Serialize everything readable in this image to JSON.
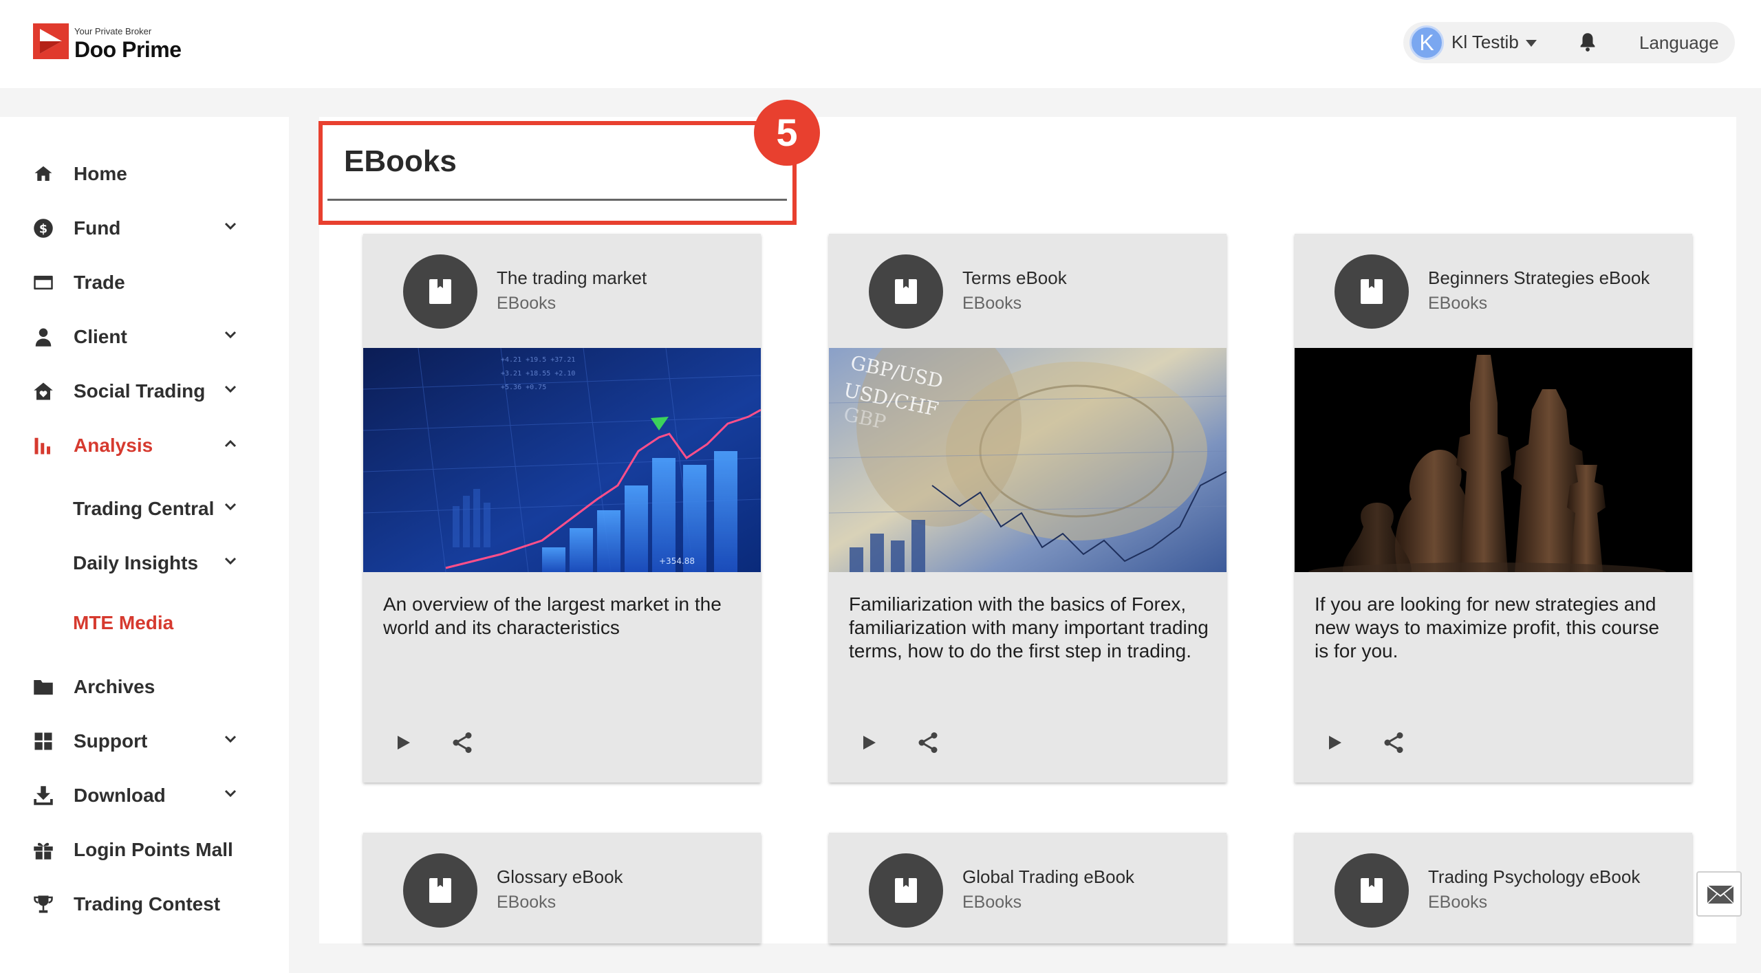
{
  "header": {
    "logo_tagline": "Your Private Broker",
    "logo_name": "Doo Prime",
    "user": {
      "initial": "K",
      "name": "Kl Testib"
    },
    "language_label": "Language"
  },
  "sidebar": {
    "items": [
      {
        "label": "Home",
        "icon": "home-icon",
        "expandable": false
      },
      {
        "label": "Fund",
        "icon": "dollar-icon",
        "expandable": true
      },
      {
        "label": "Trade",
        "icon": "card-icon",
        "expandable": false
      },
      {
        "label": "Client",
        "icon": "person-icon",
        "expandable": true
      },
      {
        "label": "Social Trading",
        "icon": "house-heart-icon",
        "expandable": true
      },
      {
        "label": "Analysis",
        "icon": "bar-chart-icon",
        "expandable": true,
        "active": true
      },
      {
        "label": "Trading Central",
        "sub": true,
        "expandable": true
      },
      {
        "label": "Daily Insights",
        "sub": true,
        "expandable": true
      },
      {
        "label": "MTE Media",
        "sub": true,
        "active": true
      },
      {
        "label": "Archives",
        "icon": "folder-icon",
        "expandable": false
      },
      {
        "label": "Support",
        "icon": "grid-icon",
        "expandable": true
      },
      {
        "label": "Download",
        "icon": "download-icon",
        "expandable": true
      },
      {
        "label": "Login Points Mall",
        "icon": "gift-icon",
        "expandable": false
      },
      {
        "label": "Trading Contest",
        "icon": "trophy-icon",
        "expandable": false
      }
    ]
  },
  "annotation": {
    "step": "5"
  },
  "main": {
    "title": "EBooks",
    "cards": [
      {
        "title": "The trading market",
        "subtitle": "EBooks",
        "description": "An overview of the largest market in the world and its characteristics"
      },
      {
        "title": "Terms eBook",
        "subtitle": "EBooks",
        "description": "Familiarization with the basics of Forex, familiarization with many important trading terms, how to do the first step in trading."
      },
      {
        "title": "Beginners Strategies eBook",
        "subtitle": "EBooks",
        "description": "If you are looking for new strategies and new ways to maximize profit, this course is for you."
      },
      {
        "title": "Glossary eBook",
        "subtitle": "EBooks"
      },
      {
        "title": "Global Trading eBook",
        "subtitle": "EBooks"
      },
      {
        "title": "Trading Psychology eBook",
        "subtitle": "EBooks"
      }
    ]
  },
  "colors": {
    "accent": "#d63a2f",
    "annotation": "#e8402f",
    "card_bg": "#e7e7e7",
    "avatar": "#7aa7f0"
  }
}
